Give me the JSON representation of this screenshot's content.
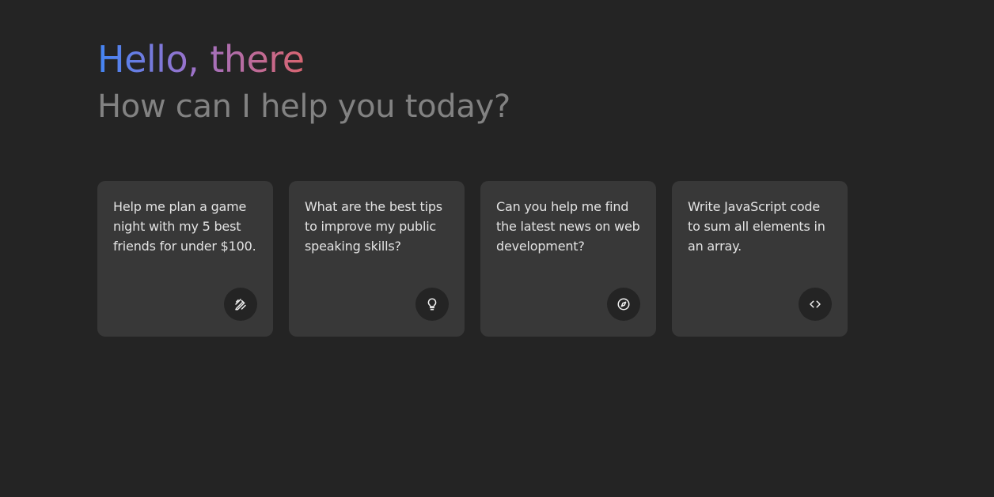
{
  "greeting": {
    "title": "Hello, there",
    "subtitle": "How can I help you today?"
  },
  "suggestions": [
    {
      "text": "Help me plan a game night with my 5 best friends for under $100.",
      "icon": "draw-icon"
    },
    {
      "text": "What are the best tips to improve my public speaking skills?",
      "icon": "lightbulb-icon"
    },
    {
      "text": "Can you help me find the latest news on web development?",
      "icon": "explore-icon"
    },
    {
      "text": "Write JavaScript code to sum all elements in an array.",
      "icon": "code-icon"
    }
  ],
  "colors": {
    "background": "#242424",
    "card": "#383838",
    "subtitle": "#828282",
    "gradient_start": "#4285f4",
    "gradient_end": "#d96570"
  }
}
